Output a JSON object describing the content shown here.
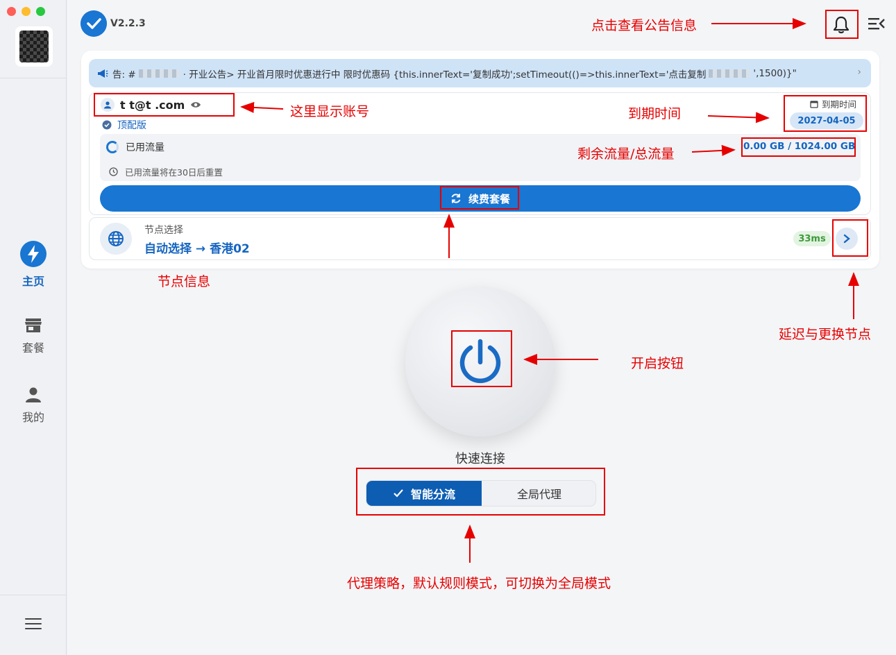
{
  "sidebar": {
    "items": [
      {
        "label": "主页",
        "icon": "lightning-icon",
        "active": true
      },
      {
        "label": "套餐",
        "icon": "store-icon"
      },
      {
        "label": "我的",
        "icon": "person-icon"
      }
    ]
  },
  "header": {
    "version": "V2.2.3"
  },
  "notice": {
    "prefix": "告: #",
    "text": "· 开业公告> 开业首月限时优惠进行中 限时优惠码 {this.innerText='复制成功';setTimeout(()=>this.innerText='点击复制",
    "suffix": "',1500)}\""
  },
  "account": {
    "email": "t  t@t  .com",
    "tier": "顶配版",
    "expiry_label": "到期时间",
    "expiry_date": "2027-04-05"
  },
  "traffic": {
    "used_label": "已用流量",
    "reset_note": "已用流量将在30日后重置",
    "value": "0.00 GB / 1024.00 GB"
  },
  "renew_label": "续费套餐",
  "node": {
    "caption": "节点选择",
    "name": "自动选择 → 香港02",
    "latency": "33ms"
  },
  "connect": {
    "label": "快速连接"
  },
  "mode": {
    "smart": "智能分流",
    "global": "全局代理",
    "selected": "smart"
  },
  "annotations": {
    "notice": "点击查看公告信息",
    "account": "这里显示账号",
    "expiry": "到期时间",
    "traffic": "剩余流量/总流量",
    "node": "节点信息",
    "latency": "延迟与更换节点",
    "power": "开启按钮",
    "mode": "代理策略，默认规则模式，可切换为全局模式"
  },
  "colors": {
    "accent": "#1976d2",
    "annotation": "#e60000",
    "latency_green": "#3e9a3a"
  }
}
